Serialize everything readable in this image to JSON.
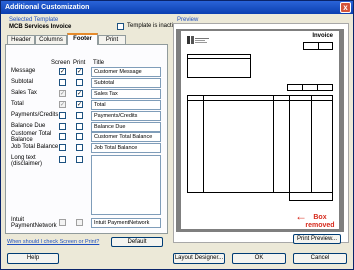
{
  "window": {
    "title": "Additional Customization",
    "close": "x"
  },
  "template": {
    "label": "Selected Template",
    "name": "MCB Services Invoice",
    "inactive_label": "Template is inactive"
  },
  "tabs": [
    {
      "label": "Header"
    },
    {
      "label": "Columns"
    },
    {
      "label": "Footer"
    },
    {
      "label": "Print"
    }
  ],
  "columns": {
    "screen": "Screen",
    "print": "Print",
    "title": "Title"
  },
  "rows": [
    {
      "label": "Message",
      "screen": true,
      "print": true,
      "title": "Customer Message"
    },
    {
      "label": "Subtotal",
      "screen": false,
      "print": false,
      "title": "Subtotal"
    },
    {
      "label": "Sales Tax",
      "screen": true,
      "print": true,
      "title": "Sales Tax"
    },
    {
      "label": "Total",
      "screen": true,
      "print": true,
      "title": "Total"
    },
    {
      "label": "Payments/Credits",
      "screen": false,
      "print": false,
      "title": "Payments/Credits"
    },
    {
      "label": "Balance Due",
      "screen": false,
      "print": false,
      "title": "Balance Due"
    },
    {
      "label": "Customer Total Balance",
      "screen": false,
      "print": false,
      "title": "Customer Total Balance"
    },
    {
      "label": "Job Total Balance",
      "screen": false,
      "print": false,
      "title": "Job Total Balance"
    },
    {
      "label": "Long text (disclaimer)",
      "screen": false,
      "print": false,
      "title": ""
    },
    {
      "label": "Intuit PaymentNetwork",
      "screen": false,
      "print": false,
      "title": "Intuit PaymentNetwork"
    }
  ],
  "help_link": "When should I check Screen or Print?",
  "default_button": "Default",
  "preview": {
    "label": "Preview",
    "doc_title": "Invoice",
    "print_preview_button": "Print Preview..."
  },
  "annotation": {
    "text": "Box removed",
    "arrow": "←",
    "color": "#d62a1c"
  },
  "bottom_buttons": {
    "help": "Help",
    "layout_designer": "Layout Designer...",
    "ok": "OK",
    "cancel": "Cancel"
  },
  "check_glyph": "✓"
}
